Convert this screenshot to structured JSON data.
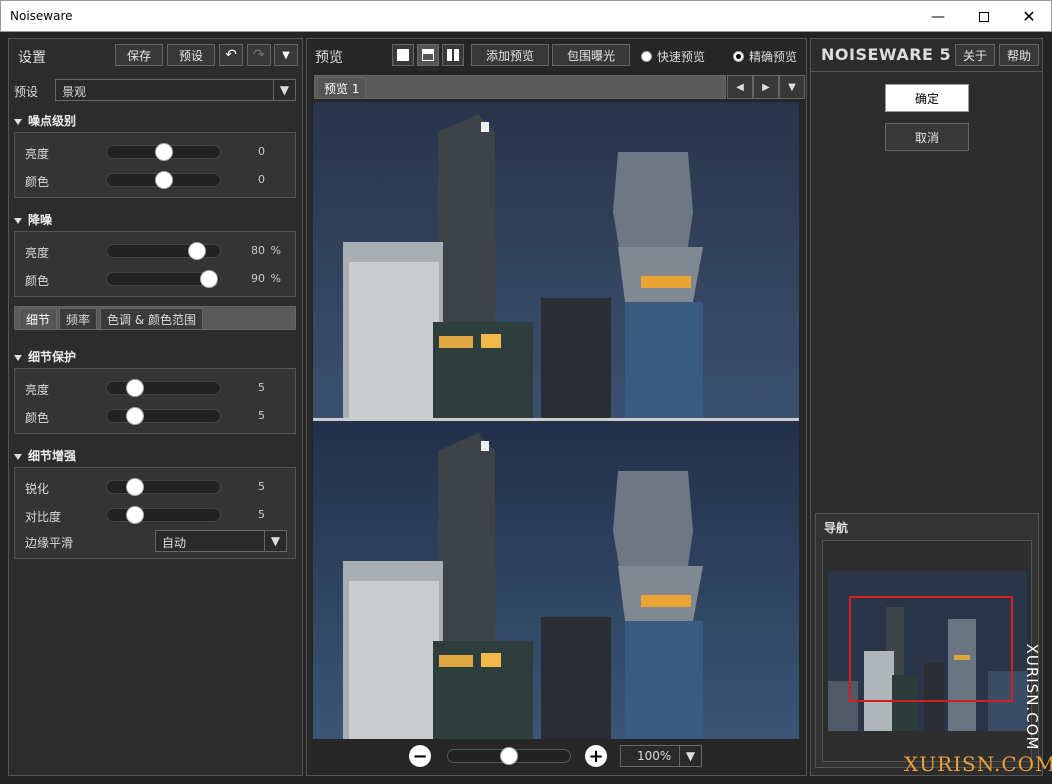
{
  "window": {
    "title": "Noiseware"
  },
  "left": {
    "settings_label": "设置",
    "save_label": "保存",
    "preset_btn_label": "预设",
    "preset_label": "预设",
    "preset_value": "景观",
    "noise_level": {
      "title": "噪点级别",
      "luma_label": "亮度",
      "luma_value": "0",
      "luma_level": 0.5,
      "color_label": "颜色",
      "color_value": "0",
      "color_level": 0.5
    },
    "denoise": {
      "title": "降噪",
      "luma_label": "亮度",
      "luma_value": "80",
      "luma_unit": "%",
      "luma_level": 0.8,
      "color_label": "颜色",
      "color_value": "90",
      "color_unit": "%",
      "color_level": 0.9
    },
    "tabs": [
      "细节",
      "频率",
      "色调 & 颜色范围"
    ],
    "detail_protect": {
      "title": "细节保护",
      "luma_label": "亮度",
      "luma_value": "5",
      "luma_level": 0.25,
      "color_label": "颜色",
      "color_value": "5",
      "color_level": 0.25
    },
    "detail_enhance": {
      "title": "细节增强",
      "sharpen_label": "锐化",
      "sharpen_value": "5",
      "sharpen_level": 0.25,
      "contrast_label": "对比度",
      "contrast_value": "5",
      "contrast_level": 0.25,
      "edge_label": "边缘平滑",
      "edge_value": "自动"
    }
  },
  "center": {
    "title": "预览",
    "add_preview_label": "添加预览",
    "envelope_label": "包围曝光",
    "fast_preview_label": "快速预览",
    "precise_preview_label": "精确预览",
    "tab_label": "预览 1",
    "zoom_value": "100%",
    "zoom_level": 0.5
  },
  "right": {
    "logo": "NOISEWARE 5",
    "about_label": "关于",
    "help_label": "帮助",
    "ok_label": "确定",
    "cancel_label": "取消",
    "nav_label": "导航"
  },
  "watermark": {
    "side": "XURISN.COM",
    "bottom": "XURISN.COM"
  }
}
